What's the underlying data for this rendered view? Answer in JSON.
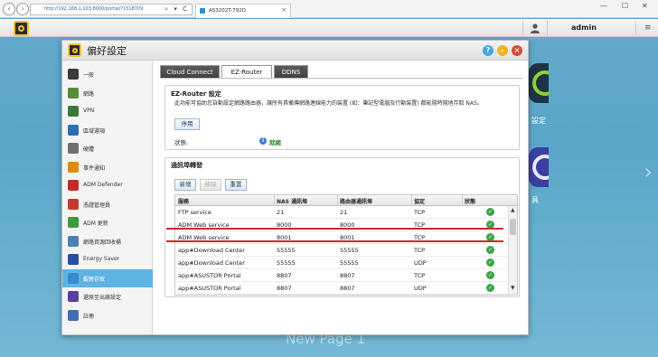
{
  "browser": {
    "url": "http://192.168.1.103:8000/portal/?1518709",
    "url_controls": "⌕ ▾ C",
    "tab_title": "AS3202T-792D",
    "tab_close": "×",
    "back_glyph": "‹",
    "forward_glyph": "›",
    "win_minimize": "—",
    "win_maximize": "☐",
    "win_close": "✕",
    "toolbar_icons": "⌂ ☆ ⚙"
  },
  "adm": {
    "user": "admin",
    "menu_glyph": "≡"
  },
  "desktop": {
    "label_1": "設定",
    "label_2": "具",
    "bg_text": "New Page 1",
    "arrow": "›"
  },
  "window": {
    "title": "偏好設定",
    "help": "?",
    "minimize": "–",
    "close": "×"
  },
  "sidebar": {
    "items": [
      {
        "label": "一般",
        "color": "#3b3b3b"
      },
      {
        "label": "網路",
        "color": "#5a8a3a"
      },
      {
        "label": "VPN",
        "color": "#3a7a3a"
      },
      {
        "label": "區域選項",
        "color": "#2e6fb0"
      },
      {
        "label": "硬體",
        "color": "#6f6f6f"
      },
      {
        "label": "事件通知",
        "color": "#e08a10"
      },
      {
        "label": "ADM Defender",
        "color": "#c22a2a"
      },
      {
        "label": "憑證管理員",
        "color": "#c23a2a"
      },
      {
        "label": "ADM 更新",
        "color": "#3d9a3d"
      },
      {
        "label": "網路資源回收桶",
        "color": "#4f7fb4"
      },
      {
        "label": "Energy Saver",
        "color": "#2a4fa0"
      },
      {
        "label": "觀察存取",
        "color": "#3a8ad0"
      },
      {
        "label": "還原至出廠設定",
        "color": "#5b3f9c"
      },
      {
        "label": "註冊",
        "color": "#3f6fb0"
      }
    ],
    "active_index": 11
  },
  "tabs": [
    "Cloud Connect",
    "EZ-Router",
    "DDNS"
  ],
  "active_tab": 1,
  "ez_router": {
    "title": "EZ-Router 設定",
    "description": "此功能可協助您自動設定網路路由器，讓所有具備傳網路連線能力的裝置 (如：筆記型電腦及行動裝置) 都能隨時隨地存取 NAS。",
    "disable_button": "停用",
    "status_label": "狀態:",
    "status_value": "就緒"
  },
  "forwarding": {
    "title": "通訊埠轉發",
    "add_button": "新增",
    "remove_button": "移除",
    "reset_button": "重置",
    "columns": [
      "服務",
      "NAS 通訊埠",
      "路由器通訊埠",
      "協定",
      "狀態"
    ],
    "rows": [
      {
        "service": "FTP service",
        "nas_port": "21",
        "router_port": "21",
        "protocol": "TCP",
        "status": "✓"
      },
      {
        "service": "ADM Web service",
        "nas_port": "8000",
        "router_port": "8000",
        "protocol": "TCP",
        "status": "✓"
      },
      {
        "service": "ADM Web service",
        "nas_port": "8001",
        "router_port": "8001",
        "protocol": "TCP",
        "status": "✓"
      },
      {
        "service": "app#Download Center",
        "nas_port": "55555",
        "router_port": "55555",
        "protocol": "TCP",
        "status": "✓"
      },
      {
        "service": "app#Download Center",
        "nas_port": "55555",
        "router_port": "55555",
        "protocol": "UDP",
        "status": "✓"
      },
      {
        "service": "app#ASUSTOR Portal",
        "nas_port": "8807",
        "router_port": "8807",
        "protocol": "TCP",
        "status": "✓"
      },
      {
        "service": "app#ASUSTOR Portal",
        "nas_port": "8807",
        "router_port": "8807",
        "protocol": "UDP",
        "status": "✓"
      }
    ],
    "scroll_up": "▲",
    "scroll_down": "▼"
  },
  "colors": {
    "highlight_line": "#d2252b",
    "active_sidebar": "#5eb3e4",
    "status_ok": "#3da34a"
  }
}
